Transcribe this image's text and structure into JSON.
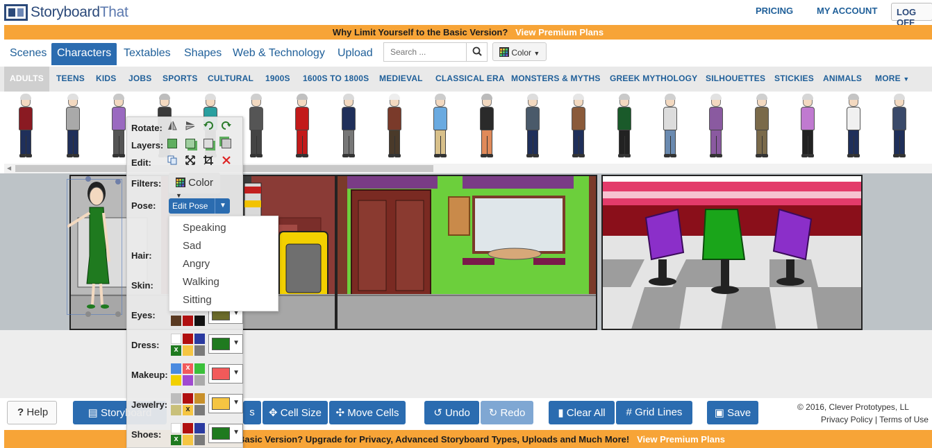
{
  "header": {
    "logo_prefix": "Storyboard",
    "logo_suffix": "That",
    "pricing": "PRICING",
    "my_account": "MY ACCOUNT",
    "log_off": "LOG OFF"
  },
  "top_banner": {
    "text": "Why Limit Yourself to the Basic Version?",
    "link": "View Premium Plans"
  },
  "tabs": [
    "Scenes",
    "Characters",
    "Textables",
    "Shapes",
    "Web & Technology",
    "Upload"
  ],
  "active_tab": "Characters",
  "search": {
    "placeholder": "Search ..."
  },
  "color_filter": {
    "label": "Color"
  },
  "categories": [
    "ADULTS",
    "TEENS",
    "KIDS",
    "JOBS",
    "SPORTS",
    "CULTURAL",
    "1900S",
    "1600S TO 1800S",
    "MEDIEVAL",
    "CLASSICAL ERA",
    "MONSTERS & MYTHS",
    "GREEK MYTHOLOGY",
    "SILHOUETTES",
    "STICKIES",
    "ANIMALS",
    "MORE"
  ],
  "active_category": "ADULTS",
  "toolbox": {
    "rotate": "Rotate:",
    "layers": "Layers:",
    "edit": "Edit:",
    "filters": "Filters:",
    "filter_value": "Color",
    "pose": "Pose:",
    "edit_pose": "Edit Pose",
    "hair": "Hair:",
    "skin": "Skin:",
    "eyes": "Eyes:",
    "dress": "Dress:",
    "makeup": "Makeup:",
    "jewelry": "Jewelry:",
    "shoes": "Shoes:",
    "selected_colors": {
      "eyes": "#6b6b2a",
      "dress": "#1f7a1f",
      "makeup": "#f25a5a",
      "jewelry": "#f5c542",
      "shoes": "#1f7a1f"
    }
  },
  "pose_menu": [
    "Speaking",
    "Sad",
    "Angry",
    "Walking",
    "Sitting"
  ],
  "bottom_bar": {
    "help": "Help",
    "storyboard": "Storyboard",
    "layout_suffix": "s",
    "cell_size": "Cell Size",
    "move_cells": "Move Cells",
    "undo": "Undo",
    "redo": "Redo",
    "clear_all": "Clear All",
    "grid_lines": "Grid Lines",
    "save": "Save",
    "copyright": "© 2016, Clever Prototypes, LL",
    "privacy": "Privacy Policy",
    "terms": "Terms of Use"
  },
  "bottom_banner": {
    "text": "to the Basic Version? Upgrade for Privacy, Advanced Storyboard Types, Uploads and Much More!",
    "link": "View Premium Plans"
  },
  "colors": {
    "brand_blue": "#2b6cb0",
    "banner_orange": "#f7a437",
    "link_blue": "#1f5f99"
  }
}
